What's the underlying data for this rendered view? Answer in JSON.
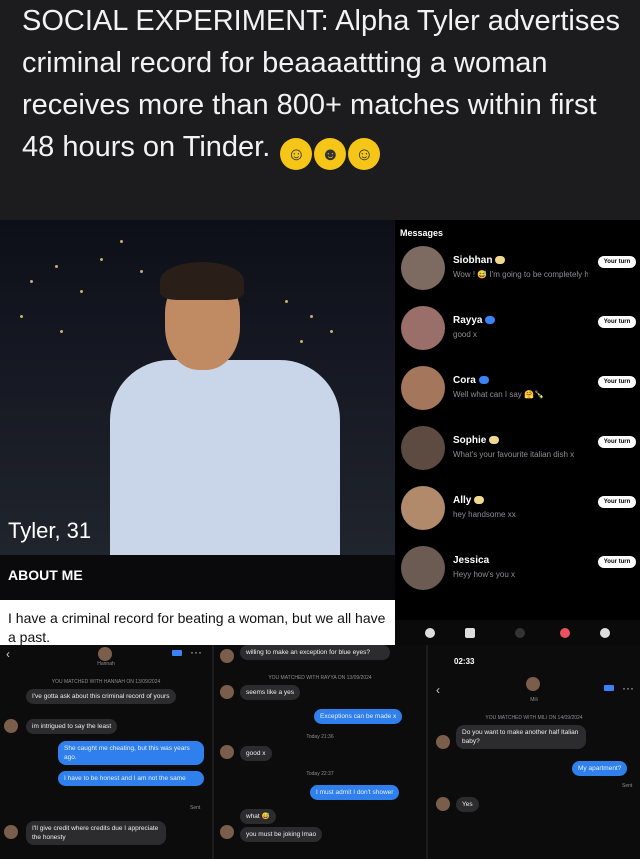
{
  "headline": {
    "text": "SOCIAL EXPERIMENT: Alpha Tyler advertises criminal record for beaaaattting a woman receives more than 800+ matches within first 48 hours on Tinder.",
    "emojis": [
      "laughing-face",
      "grimacing-face",
      "tears-of-joy-face"
    ]
  },
  "profile": {
    "name": "Tyler, 31",
    "about_label": "ABOUT ME",
    "bio": "I have a criminal record for beating a woman, but we all have a past."
  },
  "messages": {
    "title": "Messages",
    "items": [
      {
        "name": "Siobhan",
        "text": "Wow ! 😅 I'm going to be completely ho...",
        "turn": "Your turn"
      },
      {
        "name": "Rayya",
        "text": "good x",
        "turn": "Your turn"
      },
      {
        "name": "Cora",
        "text": "Well what can I say 🤗🍾",
        "turn": "Your turn"
      },
      {
        "name": "Sophie",
        "text": "What's your favourite italian dish x",
        "turn": "Your turn"
      },
      {
        "name": "Ally",
        "text": "hey handsome xx",
        "turn": "Your turn"
      },
      {
        "name": "Jessica",
        "text": "Heyy how's you x",
        "turn": "Your turn"
      }
    ]
  },
  "chat1": {
    "contact": "Hannah",
    "matched": "YOU MATCHED WITH HANNAH ON 13/09/2024",
    "b1": "I've gotta ask about this criminal record of yours",
    "b2": "im intrigued to say the least",
    "b3": "She caught me cheating, but this was years ago.",
    "b4": "I have to be honest and I am not the same",
    "sent": "Sent",
    "b5": "I'll give credit where credits due I appreciate the honesty"
  },
  "chat2": {
    "b0": "willing to make an exception for blue eyes?",
    "matched": "YOU MATCHED WITH RAYYA ON 13/09/2024",
    "b1": "seems like a yes",
    "b2": "Exceptions can be made x",
    "t1": "Today 21:36",
    "b3": "good x",
    "t2": "Today 22:37",
    "b4": "I must admit I don't shower",
    "b5": "what 😅",
    "b6": "you must be joking lmao"
  },
  "chat3": {
    "time": "02:33",
    "contact": "Mili",
    "matched": "YOU MATCHED WITH MILI ON 14/09/2024",
    "b1": "Do you want to make another half Italian baby?",
    "b2": "My apartment?",
    "sent": "Sent",
    "b3": "Yes"
  }
}
